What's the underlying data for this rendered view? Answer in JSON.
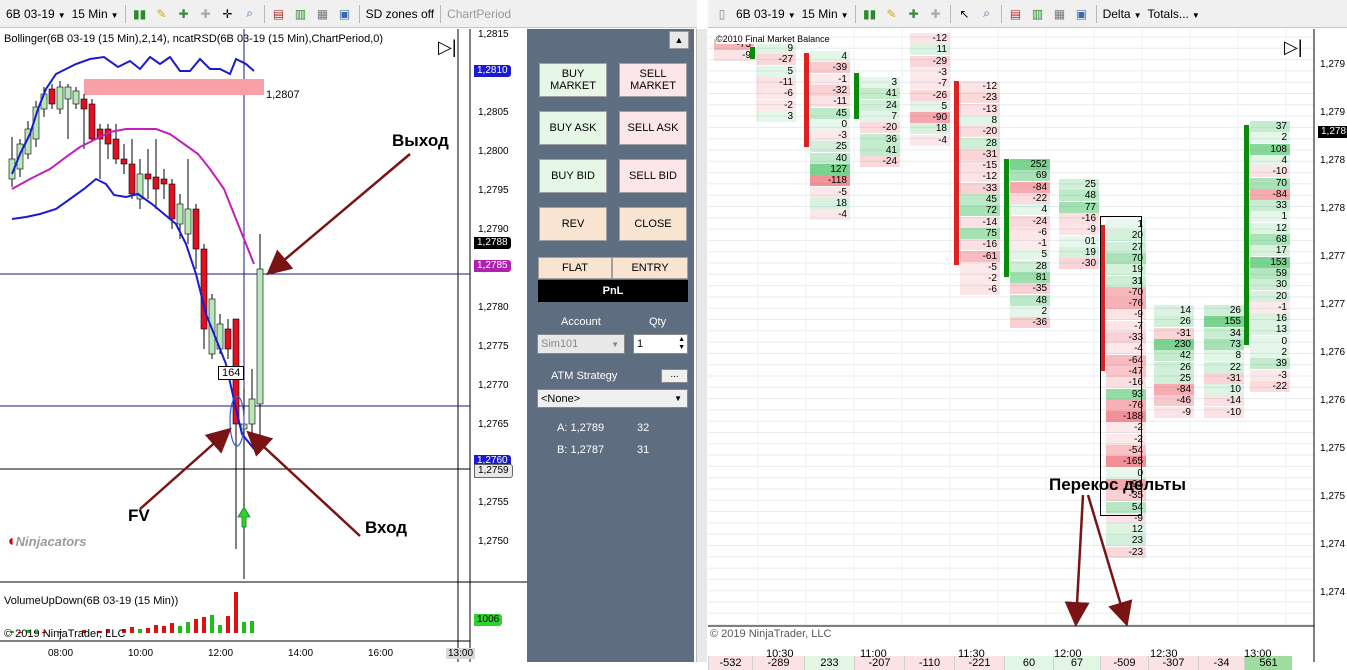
{
  "left_toolbar": {
    "instrument": "6B 03-19",
    "timeframe": "15 Min",
    "sd_zones": "SD zones off",
    "chart_period": "ChartPeriod"
  },
  "right_toolbar": {
    "instrument": "6B 03-19",
    "timeframe": "15 Min",
    "delta": "Delta",
    "totals": "Totals..."
  },
  "left_chart": {
    "indicator_label": "Bollinger(6B 03-19 (15 Min),2,14), ncatRSD(6B 03-19 (15 Min),ChartPeriod,0)",
    "zone_price": "1,2807",
    "candle_count_label": "164",
    "watermark": "Ninjacators",
    "copyright": "© 2019 NinjaTrader, LLC",
    "volume_label": "VolumeUpDown(6B 03-19 (15 Min))",
    "y_ticks": [
      "1,2815",
      "1,2810",
      "1,2805",
      "1,2800",
      "1,2795",
      "1,2790",
      "1,2785",
      "1,2780",
      "1,2775",
      "1,2770",
      "1,2765",
      "1,2760",
      "1,2755",
      "1,2750"
    ],
    "x_ticks": [
      "08:00",
      "10:00",
      "12:00",
      "14:00",
      "16:00",
      "13:00"
    ],
    "price_tags": {
      "ask_top": "1,2810",
      "last": "1,2788",
      "line_high": "1,2785",
      "line_low": "1,2760",
      "line_entry": "1,2759",
      "volume": "1006"
    },
    "annotations": {
      "exit": "Выход",
      "entry": "Вход",
      "fv": "FV"
    }
  },
  "chart_trader": {
    "buy_market": "BUY\nMARKET",
    "sell_market": "SELL\nMARKET",
    "buy_ask": "BUY ASK",
    "sell_ask": "SELL ASK",
    "buy_bid": "BUY BID",
    "sell_bid": "SELL BID",
    "rev": "REV",
    "close": "CLOSE",
    "flat": "FLAT",
    "entry": "ENTRY",
    "pnl": "PnL",
    "account_label": "Account",
    "qty_label": "Qty",
    "account_value": "Sim101",
    "qty_value": "1",
    "atm_label": "ATM Strategy",
    "atm_button": "...",
    "atm_value": "<None>",
    "ask_label": "A: 1,2789",
    "ask_size": "32",
    "bid_label": "B: 1,2787",
    "bid_size": "31"
  },
  "right_chart": {
    "header_label": "©2010 Final Market Balance",
    "copyright": "© 2019 NinjaTrader, LLC",
    "annotation": "Перекос дельты",
    "price_tag": "1,278",
    "y_ticks": [
      "1,279",
      "1,279",
      "1,278",
      "1,278",
      "1,277",
      "1,277",
      "1,276",
      "1,276",
      "1,275",
      "1,275",
      "1,274",
      "1,274"
    ],
    "x_ticks": [
      "10:30",
      "11:00",
      "11:30",
      "12:00",
      "12:30",
      "13:00"
    ],
    "bottom_deltas": [
      "-532",
      "-289",
      "233",
      "-207",
      "-110",
      "-221",
      "60",
      "67",
      "-509",
      "-307",
      "-34",
      "561"
    ],
    "footprint_columns": [
      {
        "values": [
          "-73",
          "-9"
        ]
      },
      {
        "values": [
          "9",
          "-27",
          "5",
          "-11",
          "-6",
          "-2",
          "3"
        ]
      },
      {
        "values": [
          "4",
          "-39",
          "-1",
          "-32",
          "-11",
          "45",
          "0",
          "-3",
          "25",
          "40",
          "127",
          "-118",
          "-5",
          "18",
          "-4"
        ]
      },
      {
        "values": [
          "3",
          "41",
          "24",
          "7",
          "-20",
          "36",
          "41",
          "-24"
        ]
      },
      {
        "values": [
          "-12",
          "11",
          "-29",
          "-3",
          "-7",
          "-26",
          "5",
          "-90",
          "18",
          "-4"
        ]
      },
      {
        "values": [
          "-12",
          "-23",
          "-13",
          "8",
          "-20",
          "28",
          "-31",
          "-15",
          "-12",
          "-33",
          "45",
          "72",
          "-14",
          "75",
          "-16",
          "-61",
          "-5",
          "-2",
          "-6"
        ]
      },
      {
        "values": [
          "252",
          "69",
          "-84",
          "-22",
          "4",
          "-24",
          "-6",
          "-1",
          "5",
          "28",
          "81",
          "-35",
          "48",
          "2",
          "-36"
        ]
      },
      {
        "values": [
          "25",
          "48",
          "77",
          "-16",
          "-9",
          "01",
          "19",
          "-30"
        ]
      },
      {
        "values": [
          "1",
          "20",
          "27",
          "70",
          "19",
          "31",
          "-70",
          "-76",
          "-9",
          "-7",
          "-33",
          "-4",
          "-64",
          "-47",
          "-16",
          "93",
          "-76",
          "-188",
          "-2",
          "-2",
          "-54",
          "-165",
          "0",
          "-91",
          "-35",
          "54",
          "-9",
          "12",
          "23",
          "-23"
        ]
      },
      {
        "values": [
          "14",
          "26",
          "-31",
          "230",
          "42",
          "26",
          "25",
          "-84",
          "-46",
          "-9"
        ]
      },
      {
        "values": [
          "26",
          "155",
          "34",
          "73",
          "8",
          "22",
          "-31",
          "10",
          "-14",
          "-10"
        ]
      },
      {
        "values": [
          "37",
          "2",
          "108",
          "4",
          "-10",
          "70",
          "-84",
          "33",
          "1",
          "12",
          "68",
          "17",
          "153",
          "59",
          "30",
          "20",
          "-1",
          "16",
          "13",
          "0",
          "2",
          "39",
          "-3",
          "-22"
        ]
      }
    ]
  }
}
